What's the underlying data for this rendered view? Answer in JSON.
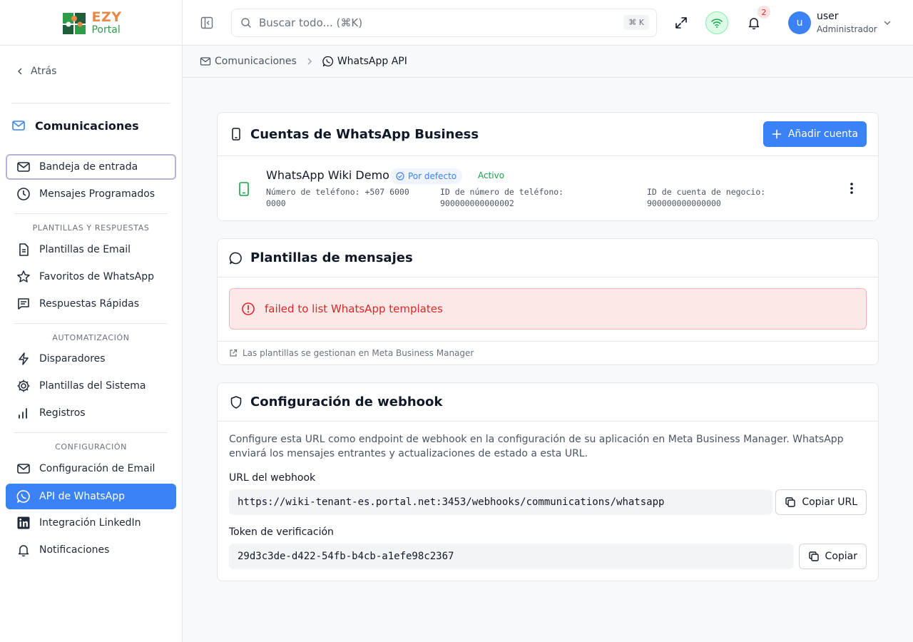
{
  "brand": {
    "line1": "EZY",
    "line2": "Portal"
  },
  "sidebar": {
    "back_label": "Atrás",
    "section_title": "Comunicaciones",
    "items": {
      "inbox": "Bandeja de entrada",
      "scheduled": "Mensajes Programados",
      "email_templates": "Plantillas de Email",
      "whatsapp_favorites": "Favoritos de WhatsApp",
      "quick_replies": "Respuestas Rápidas",
      "triggers": "Disparadores",
      "system_templates": "Plantillas del Sistema",
      "logs": "Registros",
      "email_config": "Configuración de Email",
      "whatsapp_api": "API de WhatsApp",
      "linkedin": "Integración LinkedIn",
      "notifications": "Notificaciones"
    },
    "groups": {
      "templates": "PLANTILLAS Y RESPUESTAS",
      "automation": "AUTOMATIZACIÓN",
      "config": "CONFIGURACIÓN"
    }
  },
  "header": {
    "search_placeholder": "Buscar todo... (⌘K)",
    "search_shortcut": "⌘ K",
    "notification_count": "2",
    "user_initial": "u",
    "user_name": "user",
    "user_role": "Administrador"
  },
  "breadcrumb": {
    "parent": "Comunicaciones",
    "current": "WhatsApp API"
  },
  "accounts_card": {
    "title": "Cuentas de WhatsApp Business",
    "add_button": "Añadir cuenta",
    "account": {
      "name": "WhatsApp Wiki Demo",
      "default_badge": "Por defecto",
      "status": "Activo",
      "phone_line1": "Número de teléfono: +507 6000",
      "phone_line2": "0000",
      "phone_id_label": "ID de número de teléfono:",
      "phone_id_value": "900000000000002",
      "business_id_label": "ID de cuenta de negocio:",
      "business_id_value": "900000000000000"
    }
  },
  "templates_card": {
    "title": "Plantillas de mensajes",
    "error": "failed to list WhatsApp templates",
    "footer_link": "Las plantillas se gestionan en Meta Business Manager"
  },
  "webhook_card": {
    "title": "Configuración de webhook",
    "description": "Configure esta URL como endpoint de webhook en la configuración de su aplicación en Meta Business Manager. WhatsApp enviará los mensajes entrantes y actualizaciones de estado a esta URL.",
    "url_label": "URL del webhook",
    "url_value": "https://wiki-tenant-es.portal.net:3453/webhooks/communications/whatsapp",
    "copy_url_button": "Copiar URL",
    "token_label": "Token de verificación",
    "token_value": "29d3c3de-d422-54fb-b4cb-a1efe98c2367",
    "copy_button": "Copiar"
  },
  "colors": {
    "accent": "#3b82f6",
    "success": "#16a34a",
    "error": "#dc2626"
  }
}
